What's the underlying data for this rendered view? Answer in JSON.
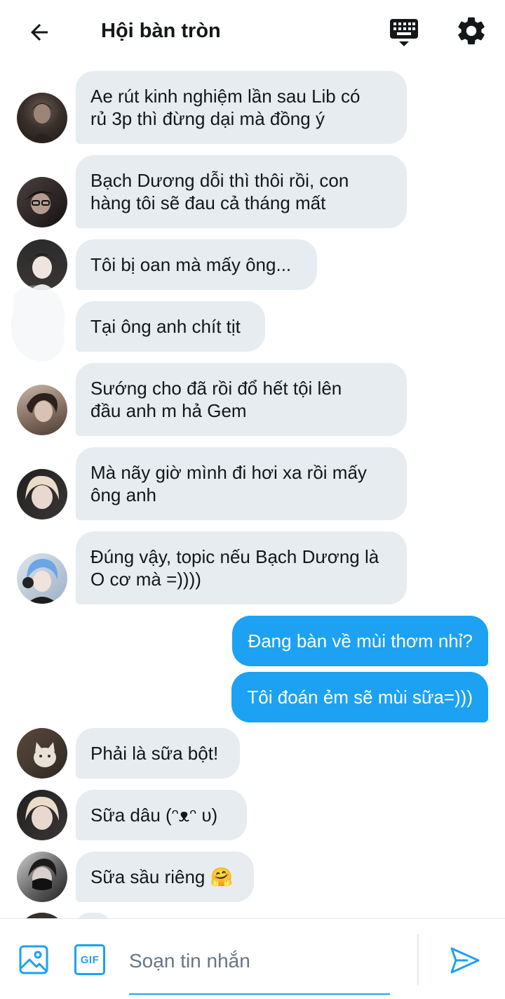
{
  "header": {
    "title": "Hội bàn tròn",
    "back_icon": "arrow-left-icon",
    "keyboard_icon": "keyboard-icon",
    "settings_icon": "gear-icon"
  },
  "colors": {
    "accent": "#1da1f2",
    "incoming_bubble": "#e6ecf0",
    "text": "#14171a",
    "placeholder": "#657786"
  },
  "messages": [
    {
      "direction": "incoming",
      "text": "Ae rút kinh nghiệm lần sau Lib có\nrủ 3p thì đừng dại mà đồng ý",
      "avatar": "dark-hair-avatar"
    },
    {
      "direction": "incoming",
      "text": "Bạch Dương dỗi thì thôi rồi, con\nhàng tôi sẽ đau cả tháng mất",
      "avatar": "glasses-avatar"
    },
    {
      "direction": "incoming",
      "text": "Tôi bị oan mà mấy ông...",
      "avatar": "pale-avatar"
    },
    {
      "direction": "incoming",
      "text": "Tại ông anh chít tịt",
      "avatar": ""
    },
    {
      "direction": "incoming",
      "text": "Sướng cho đã rồi đổ hết tội lên\nđầu anh m hả Gem",
      "avatar": "curly-hair-avatar"
    },
    {
      "direction": "incoming",
      "text": "Mà nãy giờ mình đi hơi xa rồi mấy\nông anh",
      "avatar": "blonde-avatar"
    },
    {
      "direction": "incoming",
      "text": "Đúng vậy, topic nếu Bạch Dương là\nO cơ mà =))))",
      "avatar": "blue-hair-avatar"
    },
    {
      "direction": "outgoing",
      "text": "Đang bàn về mùi thơm nhỉ?"
    },
    {
      "direction": "outgoing",
      "text": "Tôi đoán ẻm sẽ mùi sữa=)))"
    },
    {
      "direction": "incoming",
      "text": "Phải là sữa bột!",
      "avatar": "cat-avatar"
    },
    {
      "direction": "incoming",
      "text": "Sữa dâu (ᵔᴥᵔ υ)",
      "avatar": "blonde-avatar-2"
    },
    {
      "direction": "incoming",
      "text": "Sữa sầu riêng 🤗",
      "avatar": "masked-avatar"
    }
  ],
  "composer": {
    "placeholder": "Soạn tin nhắn",
    "image_icon": "image-icon",
    "gif_label": "GIF",
    "send_icon": "send-icon"
  }
}
